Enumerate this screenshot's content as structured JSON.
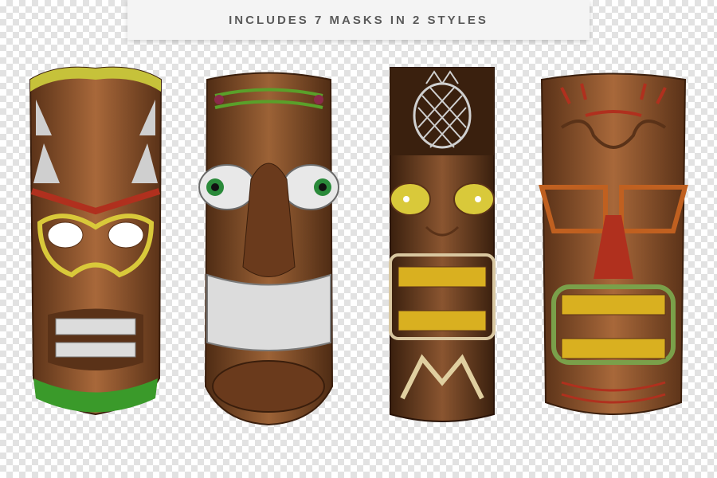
{
  "banner": {
    "text": "INCLUDES 7 MASKS IN 2 STYLES"
  },
  "masks": [
    {
      "name": "tiki-mask-1"
    },
    {
      "name": "tiki-mask-2"
    },
    {
      "name": "tiki-mask-3"
    },
    {
      "name": "tiki-mask-4"
    }
  ],
  "colors": {
    "checker_light": "#ffffff",
    "checker_dark": "#e2e2e2",
    "wood": "#8a5530",
    "wood_dark": "#5a3218",
    "accent_yellow": "#d9c93a",
    "accent_red": "#b0301e",
    "accent_green": "#3a9a2a"
  }
}
